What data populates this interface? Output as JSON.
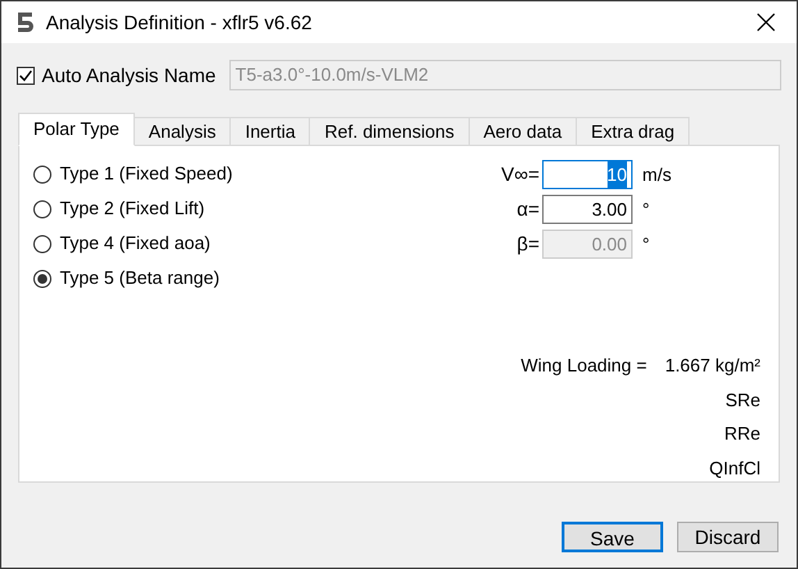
{
  "window": {
    "title": "Analysis Definition - xflr5 v6.62"
  },
  "auto_name": {
    "label": "Auto Analysis Name",
    "checked": true,
    "value": "T5-a3.0°-10.0m/s-VLM2",
    "disabled": true
  },
  "tabs": [
    {
      "label": "Polar Type",
      "selected": true
    },
    {
      "label": "Analysis",
      "selected": false
    },
    {
      "label": "Inertia",
      "selected": false
    },
    {
      "label": "Ref. dimensions",
      "selected": false
    },
    {
      "label": "Aero data",
      "selected": false
    },
    {
      "label": "Extra drag",
      "selected": false
    }
  ],
  "polar_types": [
    {
      "label": "Type 1 (Fixed Speed)",
      "selected": false
    },
    {
      "label": "Type 2 (Fixed Lift)",
      "selected": false
    },
    {
      "label": "Type 4 (Fixed aoa)",
      "selected": false
    },
    {
      "label": "Type 5 (Beta range)",
      "selected": true
    }
  ],
  "fields": [
    {
      "label": "V∞=",
      "value": "10",
      "unit": "m/s",
      "focused": true,
      "disabled": false
    },
    {
      "label": "α=",
      "value": "3.00",
      "unit": "°",
      "focused": false,
      "disabled": false
    },
    {
      "label": "β=",
      "value": "0.00",
      "unit": "°",
      "focused": false,
      "disabled": true
    }
  ],
  "wing_loading": {
    "label": "Wing Loading =",
    "value": "1.667 kg/m²"
  },
  "notes": [
    "SRe",
    "RRe",
    "QInfCl"
  ],
  "buttons": [
    {
      "label": "Save",
      "default": true
    },
    {
      "label": "Discard",
      "default": false
    }
  ]
}
